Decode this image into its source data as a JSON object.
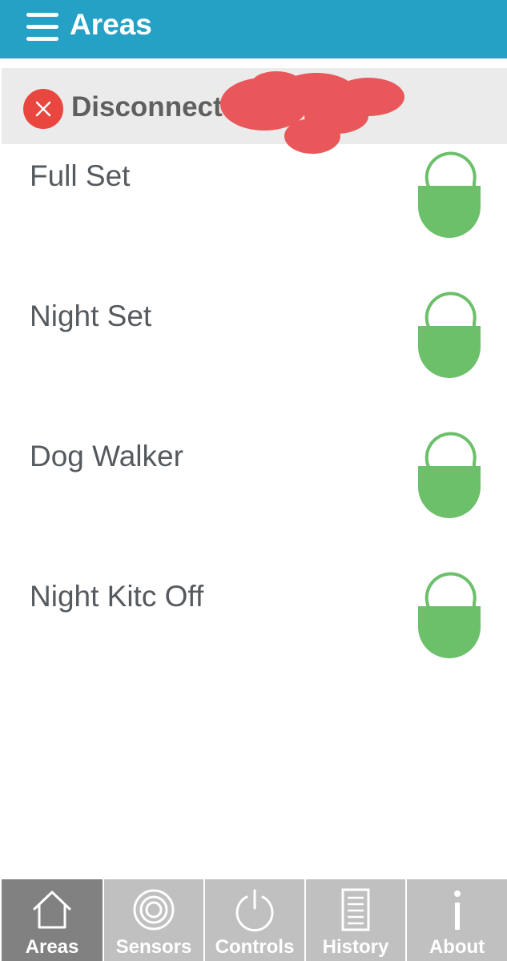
{
  "header": {
    "title": "Areas",
    "menu_icon": "hamburger-menu-icon"
  },
  "status": {
    "text": "Disconnect",
    "icon": "close-circle-icon",
    "icon_color": "#e8463e",
    "redacted": true
  },
  "areas": [
    {
      "label": "Full Set",
      "lock_state": "unlocked",
      "icon": "unlocked-padlock-icon"
    },
    {
      "label": "Night Set",
      "lock_state": "unlocked",
      "icon": "unlocked-padlock-icon"
    },
    {
      "label": "Dog Walker",
      "lock_state": "unlocked",
      "icon": "unlocked-padlock-icon"
    },
    {
      "label": "Night Kitc Off",
      "lock_state": "unlocked",
      "icon": "unlocked-padlock-icon"
    }
  ],
  "tabs": [
    {
      "label": "Areas",
      "icon": "home-icon",
      "active": true
    },
    {
      "label": "Sensors",
      "icon": "concentric-circles-icon",
      "active": false
    },
    {
      "label": "Controls",
      "icon": "power-icon",
      "active": false
    },
    {
      "label": "History",
      "icon": "document-list-icon",
      "active": false
    },
    {
      "label": "About",
      "icon": "info-icon",
      "active": false
    }
  ],
  "colors": {
    "header": "#26a1c6",
    "status_bar": "#ebebeb",
    "lock_green": "#6cc06a",
    "tab_inactive": "#c0c0c0",
    "tab_active": "#818181",
    "redaction": "#e9575a"
  }
}
